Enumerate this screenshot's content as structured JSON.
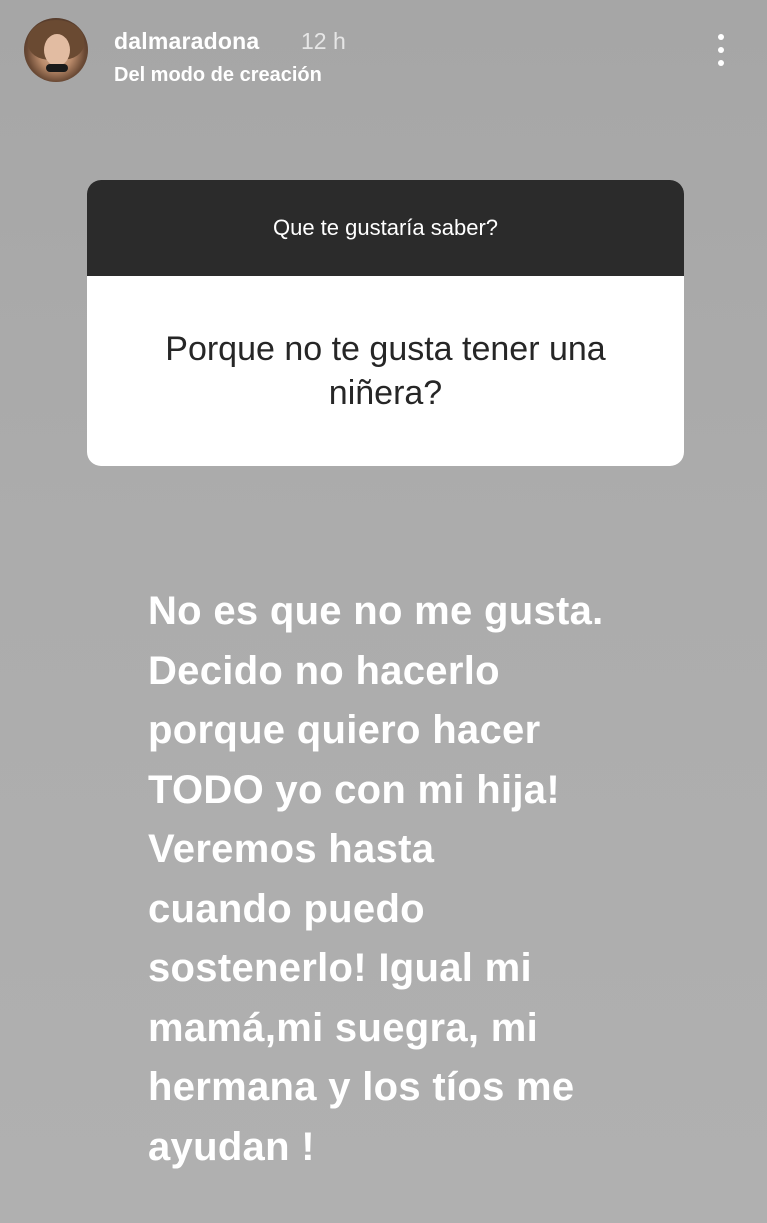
{
  "header": {
    "username": "dalmaradona",
    "time": "12 h",
    "subtitle": "Del modo de creación",
    "avatar_icon": "profile-avatar",
    "more_icon": "vertical-ellipsis-icon"
  },
  "question_sticker": {
    "prompt": "Que te gustaría saber?",
    "answer": "Porque no te gusta tener una niñera?"
  },
  "reply": {
    "text": "No es que no me gusta.\nDecido no hacerlo\nporque quiero hacer\nTODO yo con mi hija!\nVeremos hasta\ncuando puedo\nsostenerlo! Igual mi\nmamá,mi suegra, mi\nhermana y los tíos me\nayudan !"
  },
  "colors": {
    "background": "#acacac",
    "sticker_header": "#2b2b2b",
    "sticker_body": "#ffffff",
    "text_light": "#ffffff"
  }
}
